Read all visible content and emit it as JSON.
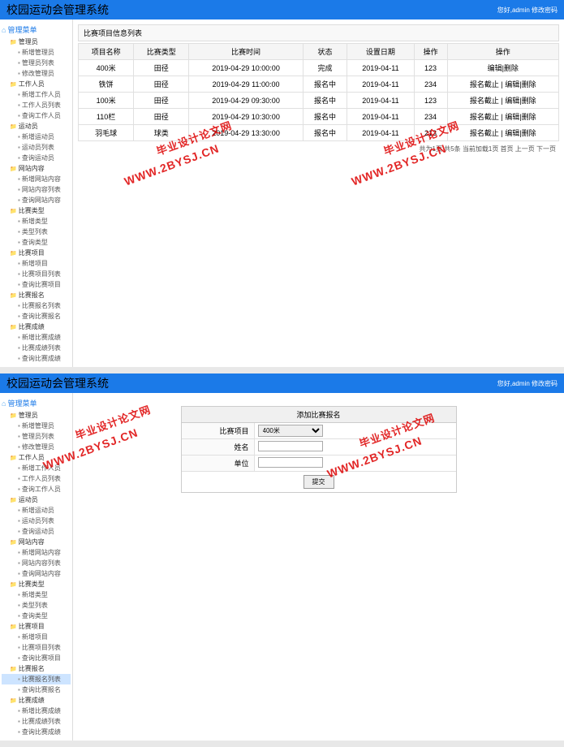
{
  "app_title": "校园运动会管理系统",
  "header_right": "您好,admin 修改密码",
  "sidebar_root": "管理菜单",
  "sidebar": [
    {
      "label": "管理员",
      "subs": [
        "新增管理员",
        "管理员列表",
        "修改管理员"
      ]
    },
    {
      "label": "工作人员",
      "subs": [
        "新增工作人员",
        "工作人员列表",
        "查询工作人员"
      ]
    },
    {
      "label": "运动员",
      "subs": [
        "新增运动员",
        "运动员列表",
        "查询运动员"
      ]
    },
    {
      "label": "网站内容",
      "subs": [
        "新增网站内容",
        "网站内容列表",
        "查询网站内容"
      ]
    },
    {
      "label": "比赛类型",
      "subs": [
        "新增类型",
        "类型列表",
        "查询类型"
      ]
    },
    {
      "label": "比赛项目",
      "subs": [
        "新增项目",
        "比赛项目列表",
        "查询比赛项目"
      ]
    },
    {
      "label": "比赛报名",
      "subs": [
        "比赛报名列表",
        "查询比赛报名"
      ]
    },
    {
      "label": "比赛成绩",
      "subs": [
        "新增比赛成绩",
        "比赛成绩列表",
        "查询比赛成绩"
      ]
    }
  ],
  "top_view": {
    "panel_title": "比赛项目信息列表",
    "columns": [
      "项目名称",
      "比赛类型",
      "比赛时间",
      "状态",
      "设置日期",
      "操作",
      "操作"
    ],
    "rows": [
      {
        "c": [
          "400米",
          "田径",
          "2019-04-29 10:00:00",
          "完成",
          "2019-04-11",
          "123",
          "编辑|删除"
        ]
      },
      {
        "c": [
          "铁饼",
          "田径",
          "2019-04-29 11:00:00",
          "报名中",
          "2019-04-11",
          "234",
          "报名截止 | 编辑|删除"
        ]
      },
      {
        "c": [
          "100米",
          "田径",
          "2019-04-29 09:30:00",
          "报名中",
          "2019-04-11",
          "123",
          "报名截止 | 编辑|删除"
        ]
      },
      {
        "c": [
          "110栏",
          "田径",
          "2019-04-29 10:30:00",
          "报名中",
          "2019-04-11",
          "234",
          "报名截止 | 编辑|删除"
        ]
      },
      {
        "c": [
          "羽毛球",
          "球类",
          "2019-04-29 13:30:00",
          "报名中",
          "2019-04-11",
          "213",
          "报名截止 | 编辑|删除"
        ]
      }
    ],
    "pager": "共为1页 共5条 当前加载1页 首页 上一页 下一页"
  },
  "bottom_view": {
    "panel_title": "添加比赛报名",
    "rows": [
      {
        "label": "比赛项目",
        "type": "select",
        "value": "400米"
      },
      {
        "label": "姓名",
        "type": "input",
        "value": ""
      },
      {
        "label": "单位",
        "type": "input",
        "value": ""
      }
    ],
    "button": "提交",
    "active_tree": "比赛报名列表"
  },
  "watermark_cn": "毕业设计论文网",
  "watermark_en": "WWW.2BYSJ.CN"
}
